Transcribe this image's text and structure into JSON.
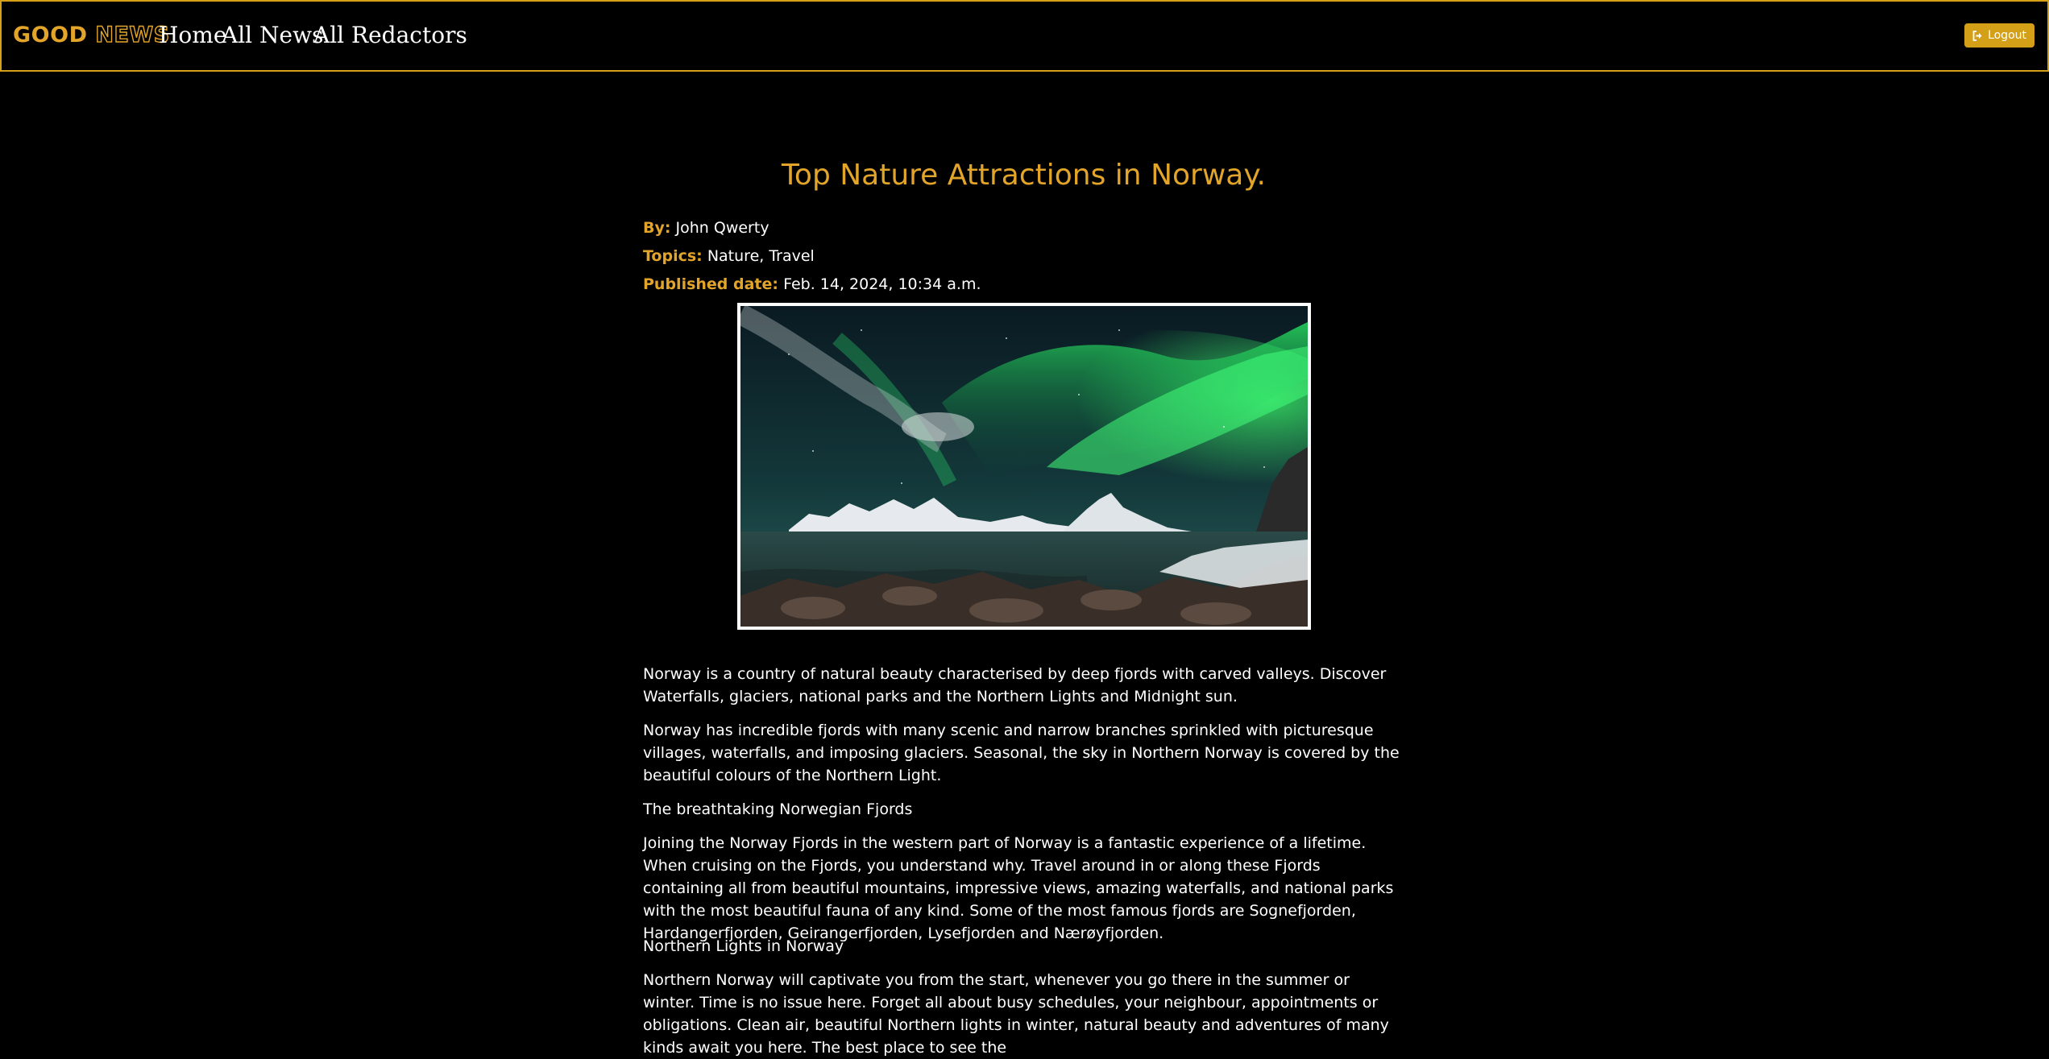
{
  "nav": {
    "brand_part1": "GOOD",
    "brand_part2": "NEWS",
    "links": [
      "Home",
      "All News",
      "All Redactors"
    ],
    "logout_label": "Logout"
  },
  "article": {
    "title": "Top Nature Attractions in Norway.",
    "by_label": "By:",
    "author": "John Qwerty",
    "topics_label": "Topics:",
    "topics": "Nature, Travel",
    "published_label": "Published date:",
    "published": "Feb. 14, 2024, 10:34 a.m.",
    "image_icon": "northern-lights-photo",
    "paragraphs": [
      "Norway is a country of natural beauty characterised by deep fjords with carved valleys. Discover Waterfalls, glaciers, national parks and the Northern Lights and Midnight sun.",
      "Norway has incredible fjords with many scenic and narrow branches sprinkled with picturesque villages, waterfalls, and imposing glaciers. Seasonal, the sky in Northern Norway is covered by the beautiful colours of the Northern Light.",
      "The breathtaking Norwegian Fjords",
      "Joining the Norway Fjords in the western part of Norway is a fantastic experience of a lifetime. When cruising on the Fjords, you understand why. Travel around in or along these Fjords containing all from beautiful mountains, impressive views, amazing waterfalls, and national parks with the most beautiful fauna of any kind. Some of the most famous fjords are Sognefjorden, Hardangerfjorden, Geirangerfjorden, Lysefjorden and Nærøyfjorden.",
      "Northern Lights in Norway",
      "Northern Norway will captivate you from the start, whenever you go there in the summer or winter. Time is no issue here. Forget all about busy schedules, your neighbour, appointments or obligations. Clean air, beautiful Northern lights in winter, natural beauty and adventures of many kinds await you here. The best place to see the"
    ]
  },
  "colors": {
    "accent": "#e2a52a",
    "background": "#000000",
    "text": "#ffffff"
  }
}
